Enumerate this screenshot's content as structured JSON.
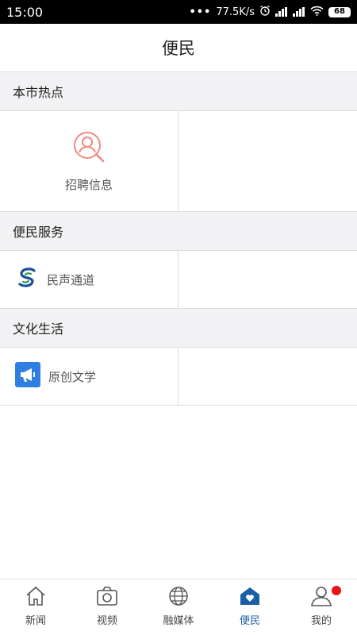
{
  "status_bar": {
    "time": "15:00",
    "dots": "•••",
    "speed": "77.5K/s",
    "battery": "68"
  },
  "header": {
    "title": "便民"
  },
  "sections": [
    {
      "title": "本市热点",
      "items": [
        {
          "label": "招聘信息",
          "icon": "recruit-search-icon"
        }
      ]
    },
    {
      "title": "便民服务",
      "items": [
        {
          "label": "民声通道",
          "icon": "s-logo-icon"
        }
      ]
    },
    {
      "title": "文化生活",
      "items": [
        {
          "label": "原创文学",
          "icon": "megaphone-icon"
        }
      ]
    }
  ],
  "colors": {
    "accent": "#1a5fa6",
    "badge": "#e8141b",
    "section_bg": "#f2f2f5",
    "icon_coral": "#ef8b80"
  },
  "bottom_nav": {
    "items": [
      {
        "label": "新闻",
        "icon": "home-icon"
      },
      {
        "label": "视频",
        "icon": "camera-icon"
      },
      {
        "label": "融媒体",
        "icon": "globe-icon"
      },
      {
        "label": "便民",
        "icon": "heart-house-icon",
        "active": true
      },
      {
        "label": "我的",
        "icon": "person-icon",
        "badge": true
      }
    ]
  }
}
